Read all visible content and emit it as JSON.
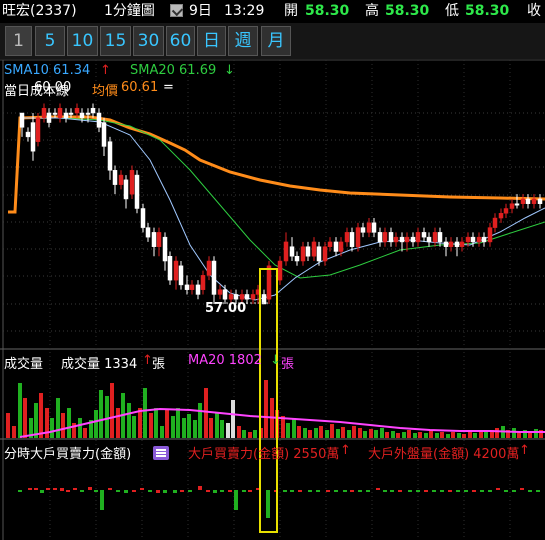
{
  "header": {
    "stock_name": "旺宏(2337)",
    "interval_label": "1分鐘圖",
    "date": "9日",
    "time": "13:29",
    "open_label": "開",
    "open_value": "58.30",
    "high_label": "高",
    "high_value": "58.30",
    "low_label": "低",
    "low_value": "58.30",
    "close_label": "收"
  },
  "period_buttons": [
    "1",
    "5",
    "10",
    "15",
    "30",
    "60",
    "日",
    "週",
    "月"
  ],
  "selected_period": "1",
  "price_panel": {
    "sma10_label": "SMA10 61.34",
    "sma20_label": "SMA20 61.69",
    "cost_line_label": "當日成本線",
    "cost_line_value": "60.00",
    "avg_label": "均價",
    "avg_value": "60.61",
    "low_annotation": "57.00"
  },
  "volume_panel": {
    "title": "成交量",
    "volume_label": "成交量 1334",
    "volume_unit": "張",
    "ma20_label": "MA20 1802",
    "ma20_unit": "張"
  },
  "bigplayer_panel": {
    "title": "分時大戶買賣力(金額)",
    "buy_power_label": "大戶買賣力(金額) 2550萬",
    "outer_label": "大戶外盤量(金額) 4200萬"
  },
  "colors": {
    "up": "#e02020",
    "down": "#20b020",
    "cost": "#ff8c1a",
    "sma10": "#a0c8ff",
    "sma20": "#2ecc40",
    "ma20": "#ff44ff",
    "highlight": "#e8e000"
  }
}
